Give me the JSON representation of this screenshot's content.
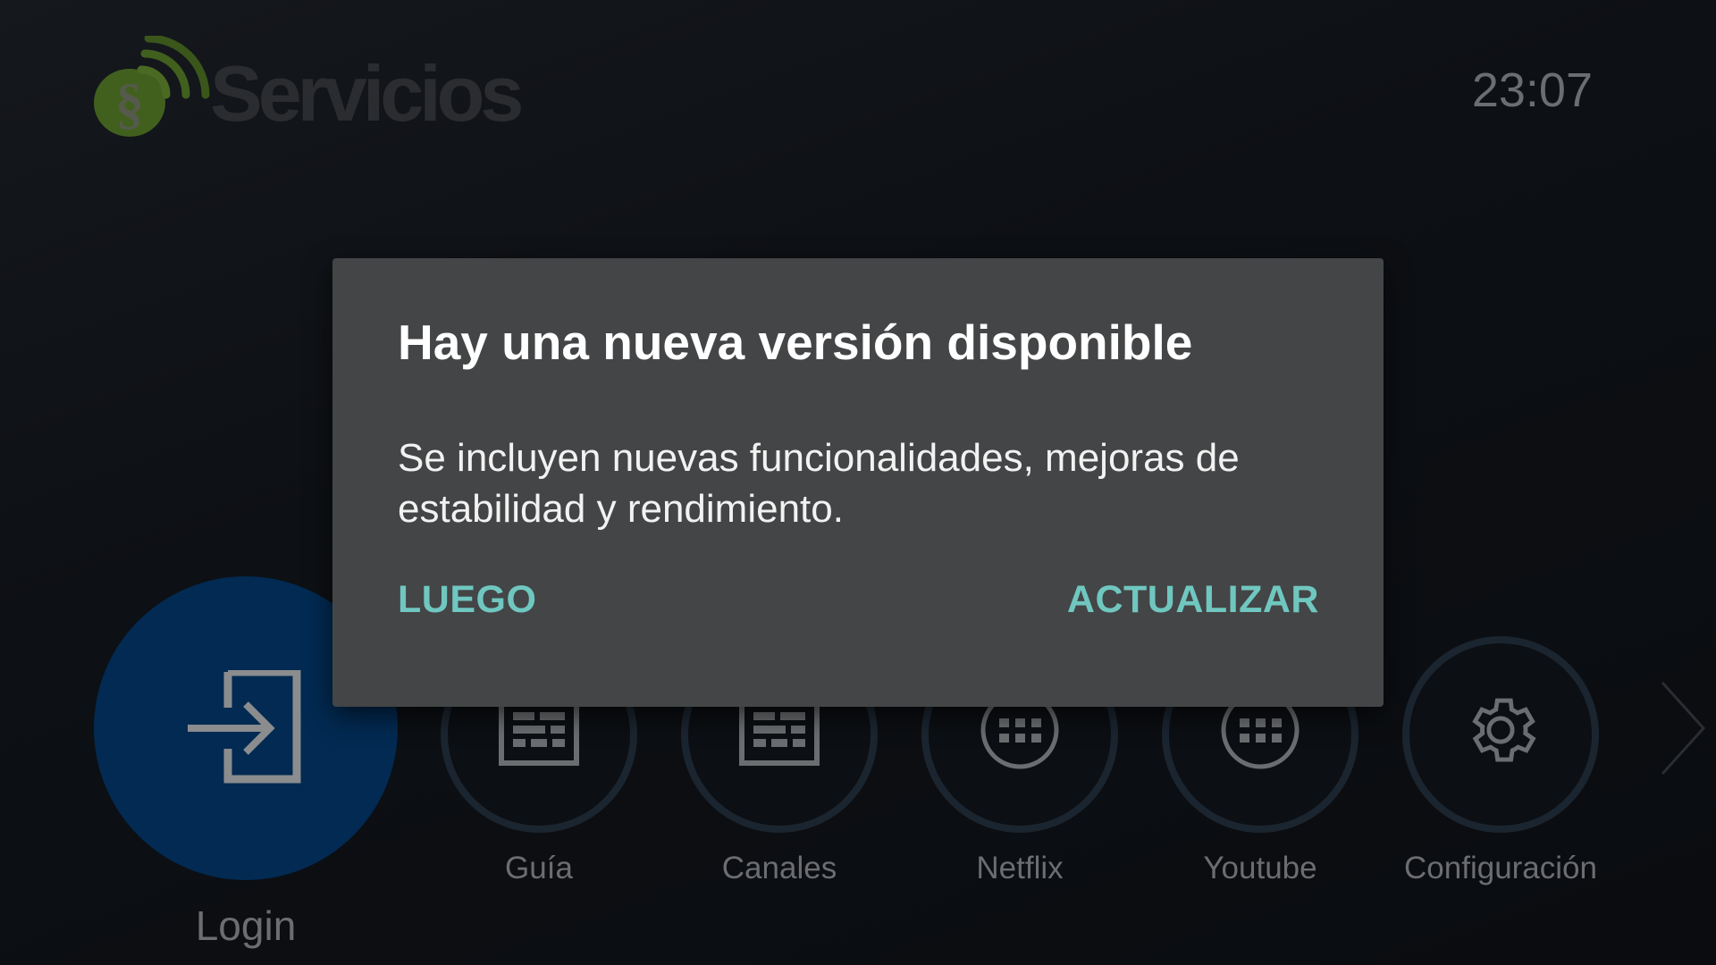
{
  "header": {
    "logo_text": "Servicios",
    "logo_symbol": "§",
    "clock": "23:07"
  },
  "menu": {
    "items": [
      {
        "label": "Login",
        "icon": "login-icon",
        "selected": true
      },
      {
        "label": "Guía",
        "icon": "guide-grid-icon"
      },
      {
        "label": "Canales",
        "icon": "channels-grid-icon"
      },
      {
        "label": "Netflix",
        "icon": "apps-dots-icon"
      },
      {
        "label": "Youtube",
        "icon": "apps-dots-icon"
      },
      {
        "label": "Configuración",
        "icon": "gear-icon"
      }
    ],
    "next_icon": "chevron-right-icon"
  },
  "dialog": {
    "title": "Hay una nueva versión disponible",
    "body": "Se incluyen nuevas funcionalidades, mejoras de estabilidad y rendimiento.",
    "later_label": "LUEGO",
    "update_label": "ACTUALIZAR"
  },
  "colors": {
    "background": "#0b0d11",
    "dialog_bg": "#444546",
    "accent": "#6fc7c0",
    "selected_circle": "#022a52",
    "logo_green": "#4a6a23",
    "muted_text": "#6b6d70"
  }
}
